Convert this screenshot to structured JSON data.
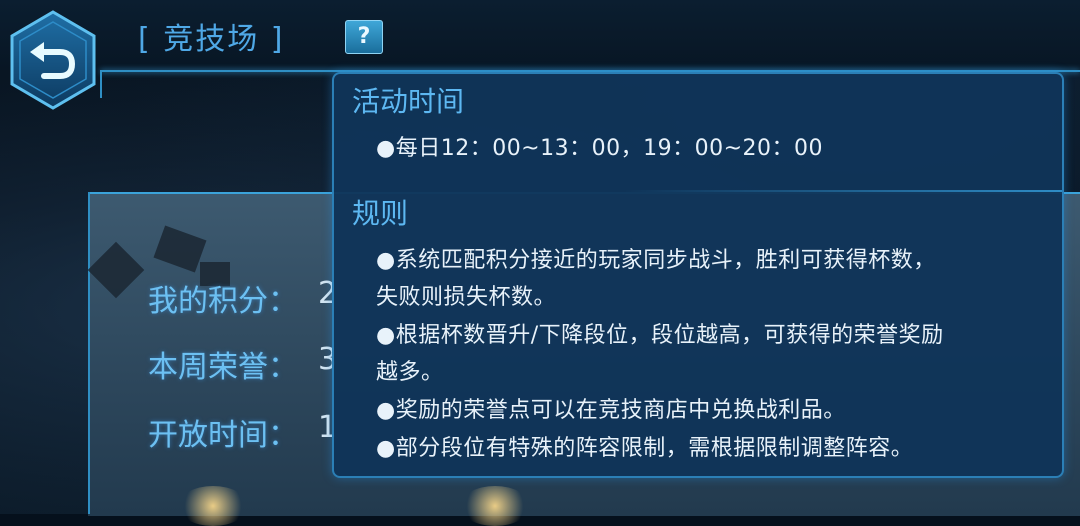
{
  "header": {
    "title": "[ 竞技场 ]",
    "help_label": "?"
  },
  "stats": {
    "my_points_label": "我的积分：",
    "my_points_value": "2",
    "weekly_honor_label": "本周荣誉：",
    "weekly_honor_value": "3",
    "open_time_label": "开放时间：",
    "open_time_value": "1"
  },
  "tooltip": {
    "activity_heading": "活动时间",
    "activity_time": "●每日12：00~13：00，19：00~20：00",
    "rules_heading": "规则",
    "rule_lines": [
      "●系统匹配积分接近的玩家同步战斗，胜利可获得杯数，",
      "失败则损失杯数。",
      "●根据杯数晋升/下降段位，段位越高，可获得的荣誉奖励",
      "越多。",
      "●奖励的荣誉点可以在竞技商店中兑换战利品。",
      "●部分段位有特殊的阵容限制，需根据限制调整阵容。"
    ]
  },
  "icons": {
    "back": "back-arrow-icon",
    "help": "question-mark-icon"
  },
  "colors": {
    "accent": "#4fa8e6",
    "tooltip_bg": "#103458",
    "border": "#2b7fb6"
  }
}
